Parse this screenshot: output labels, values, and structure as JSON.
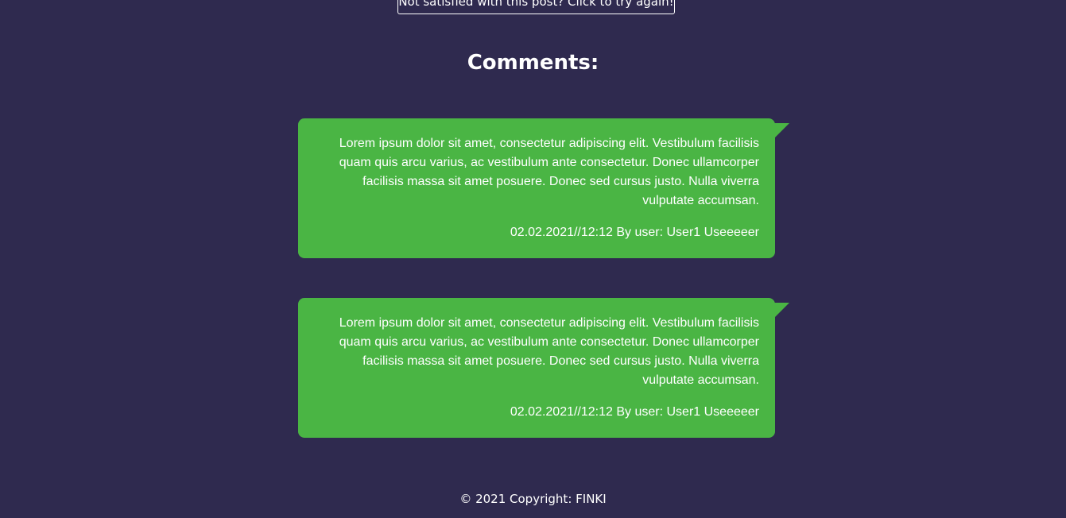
{
  "retry_button": "Not satisfied with this post? Click to try again!",
  "comments_title": "Comments:",
  "comments": [
    {
      "text": "Lorem ipsum dolor sit amet, consectetur adipiscing elit. Vestibulum facilisis quam quis arcu varius, ac vestibulum ante consectetur. Donec ullamcorper facilisis massa sit amet posuere. Donec sed cursus justo. Nulla viverra vulputate accumsan.",
      "meta": "02.02.2021//12:12 By user: User1 Useeeeer"
    },
    {
      "text": "Lorem ipsum dolor sit amet, consectetur adipiscing elit. Vestibulum facilisis quam quis arcu varius, ac vestibulum ante consectetur. Donec ullamcorper facilisis massa sit amet posuere. Donec sed cursus justo. Nulla viverra vulputate accumsan.",
      "meta": "02.02.2021//12:12 By user: User1 Useeeeer"
    }
  ],
  "footer": "© 2021 Copyright: FINKI",
  "colors": {
    "background": "#2f2a4f",
    "bubble": "#4ab544"
  }
}
